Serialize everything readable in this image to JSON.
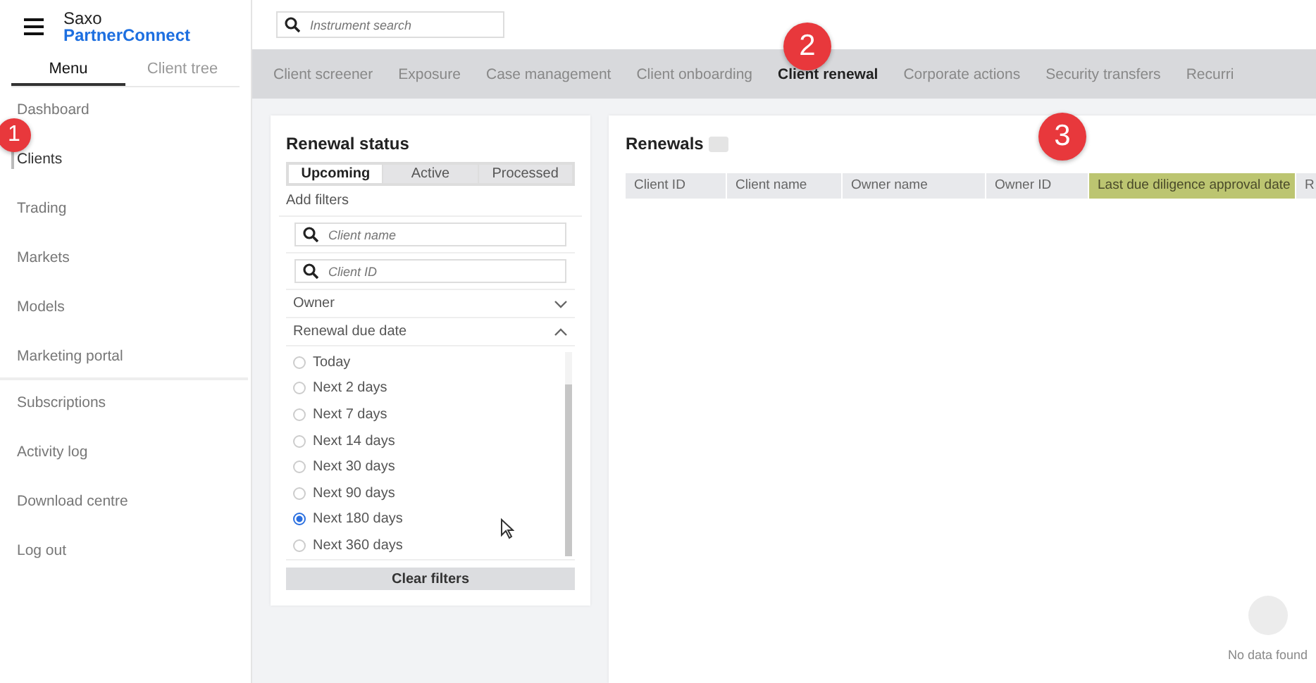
{
  "brand": {
    "line_1": "Saxo",
    "line_2": "PartnerConnect"
  },
  "sidebar": {
    "tabs": [
      {
        "label": "Menu",
        "selected": true
      },
      {
        "label": "Client tree",
        "selected": false
      }
    ],
    "sections": [
      {
        "items": [
          {
            "label": "Dashboard",
            "selected": false
          },
          {
            "label": "Clients",
            "selected": true
          },
          {
            "label": "Trading",
            "selected": false
          },
          {
            "label": "Markets",
            "selected": false
          },
          {
            "label": "Models",
            "selected": false
          },
          {
            "label": "Marketing portal",
            "selected": false
          }
        ]
      },
      {
        "items": [
          {
            "label": "Subscriptions",
            "selected": false
          },
          {
            "label": "Activity log",
            "selected": false
          },
          {
            "label": "Download centre",
            "selected": false
          },
          {
            "label": "Log out",
            "selected": false
          }
        ]
      }
    ]
  },
  "search": {
    "placeholder": "Instrument search"
  },
  "nav_tabs": [
    {
      "label": "Client screener",
      "selected": false
    },
    {
      "label": "Exposure",
      "selected": false
    },
    {
      "label": "Case management",
      "selected": false
    },
    {
      "label": "Client onboarding",
      "selected": false
    },
    {
      "label": "Client renewal",
      "selected": true
    },
    {
      "label": "Corporate actions",
      "selected": false
    },
    {
      "label": "Security transfers",
      "selected": false
    },
    {
      "label": "Recurri",
      "selected": false
    }
  ],
  "renewal_status": {
    "title": "Renewal status",
    "segments": [
      {
        "label": "Upcoming",
        "selected": true
      },
      {
        "label": "Active",
        "selected": false
      },
      {
        "label": "Processed",
        "selected": false
      }
    ],
    "add_filters": "Add filters",
    "search_fields": [
      {
        "placeholder": "Client name"
      },
      {
        "placeholder": "Client ID"
      }
    ],
    "sections": [
      {
        "label": "Owner",
        "expanded": false
      },
      {
        "label": "Renewal due date",
        "expanded": true,
        "options": [
          {
            "label": "Today",
            "selected": false
          },
          {
            "label": "Next 2 days",
            "selected": false
          },
          {
            "label": "Next 7 days",
            "selected": false
          },
          {
            "label": "Next 14 days",
            "selected": false
          },
          {
            "label": "Next 30 days",
            "selected": false
          },
          {
            "label": "Next 90 days",
            "selected": false
          },
          {
            "label": "Next 180 days",
            "selected": true
          },
          {
            "label": "Next 360 days",
            "selected": false
          }
        ]
      }
    ],
    "clear_button": "Clear filters"
  },
  "renewals": {
    "title": "Renewals",
    "columns": [
      {
        "label": "Client ID",
        "highlighted": false
      },
      {
        "label": "Client name",
        "highlighted": false
      },
      {
        "label": "Owner name",
        "highlighted": false
      },
      {
        "label": "Owner ID",
        "highlighted": false
      },
      {
        "label": "Last due diligence approval date",
        "highlighted": true
      },
      {
        "label": "R",
        "highlighted": false
      }
    ],
    "empty_text": "No data found"
  },
  "callouts": [
    {
      "label": "1"
    },
    {
      "label": "2"
    },
    {
      "label": "3"
    }
  ]
}
